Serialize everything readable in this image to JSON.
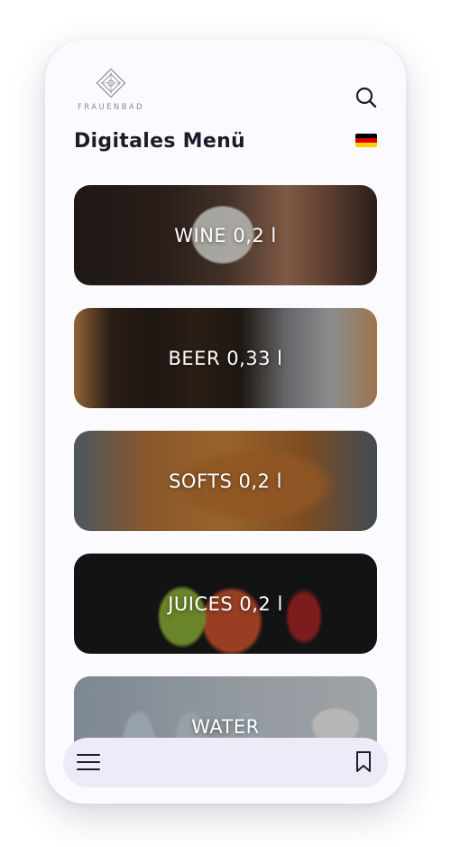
{
  "header": {
    "logo_text": "FRAUENBAD",
    "title": "Digitales Menü",
    "search_icon": "search-icon",
    "language_flag": "germany-flag-icon",
    "flag_colors": [
      "#000000",
      "#dd0000",
      "#ffce00"
    ]
  },
  "categories": [
    {
      "label": "WINE 0,2 l"
    },
    {
      "label": "BEER 0,33 l"
    },
    {
      "label": "SOFTS 0,2 l"
    },
    {
      "label": "JUICES 0,2 l"
    },
    {
      "label": "WATER"
    }
  ],
  "bottom_bar": {
    "menu_icon": "hamburger-menu-icon",
    "bookmark_icon": "bookmark-icon"
  },
  "colors": {
    "text_dark": "#1c1b29",
    "background": "#fbfaff",
    "bottom_bar": "#ecebf7"
  }
}
